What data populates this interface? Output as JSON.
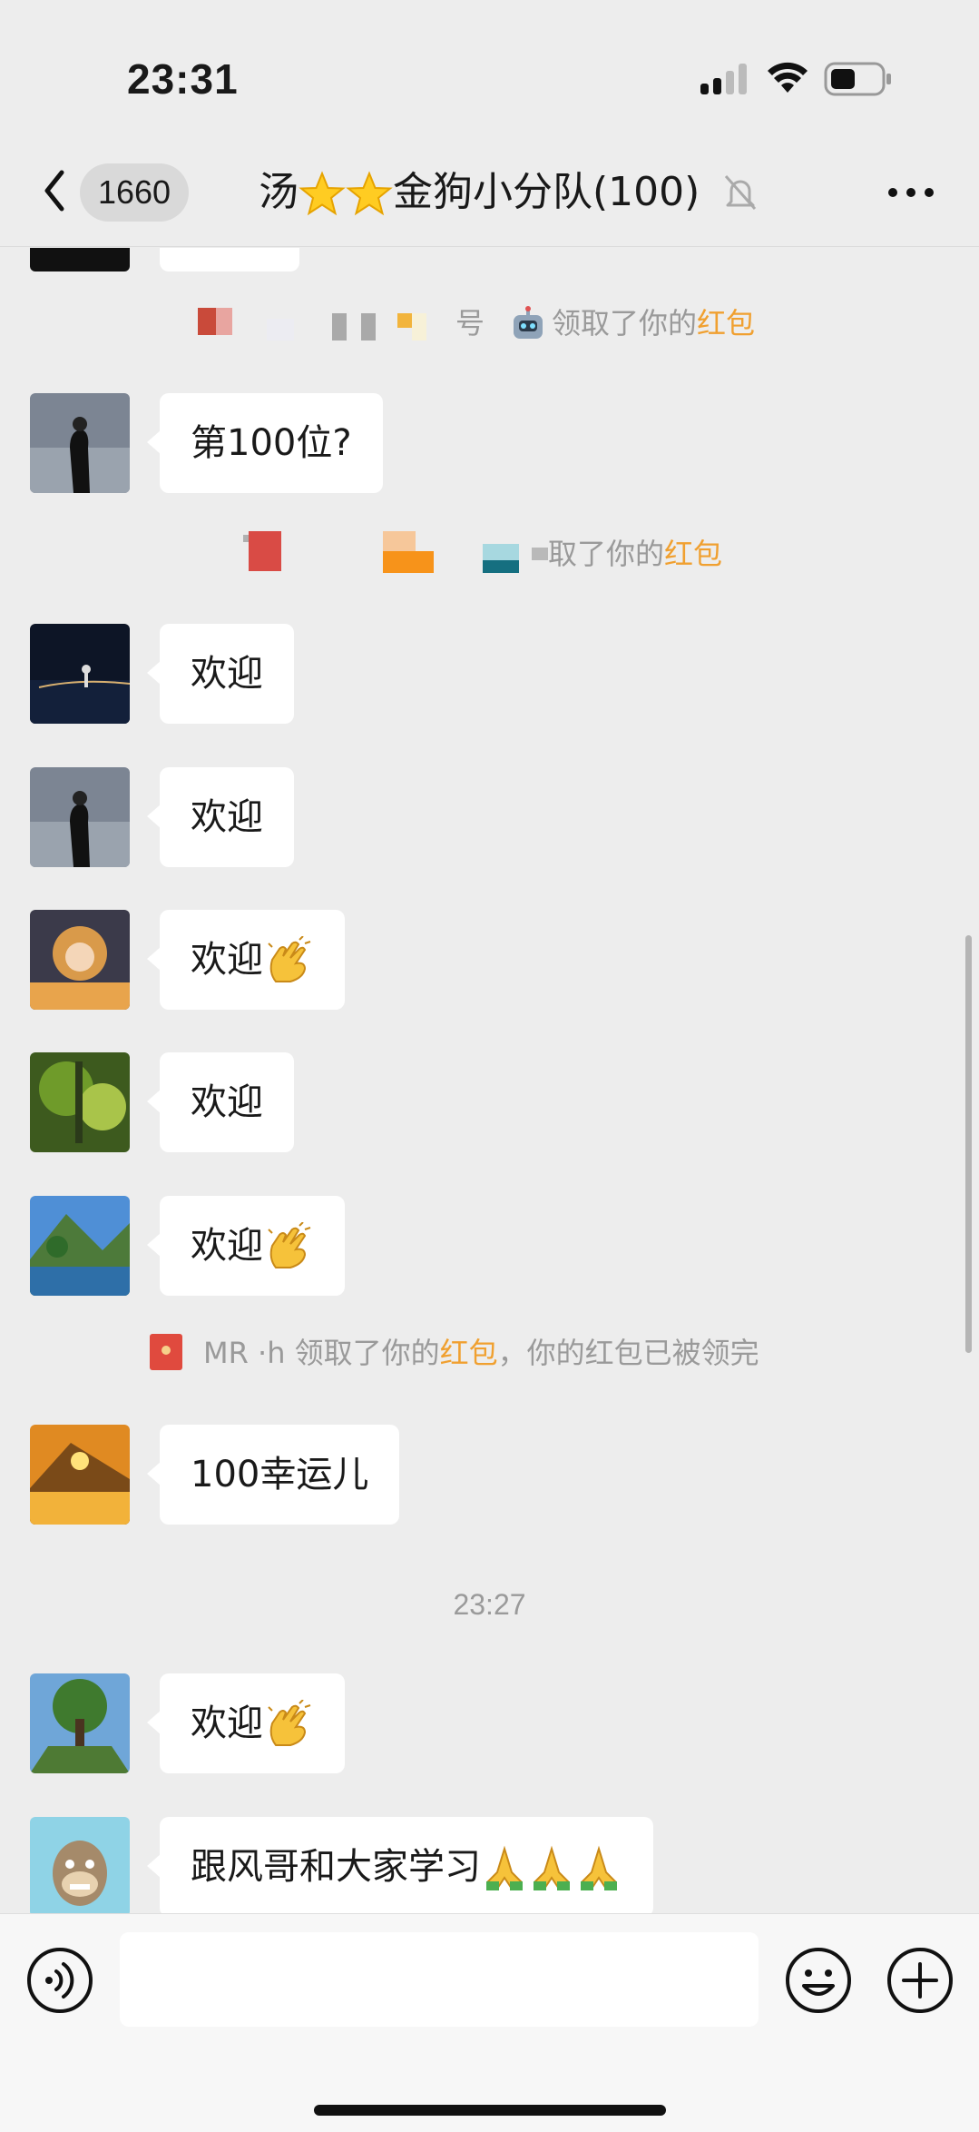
{
  "status_bar": {
    "time": "23:31",
    "icons": [
      "signal-icon",
      "wifi-icon",
      "battery-icon"
    ]
  },
  "nav": {
    "back_icon": "chevron-left-icon",
    "unread_count": "1660",
    "title_prefix": "汤",
    "title_suffix": "金狗小分队(100)",
    "mute_icon": "bell-slash-icon",
    "more_icon": "ellipsis-icon"
  },
  "system": {
    "redpack1_suffix": "号",
    "redpack1_text": "领取了你的",
    "redpack_link": "红包",
    "redpack2_text": "取了你的",
    "redpack3_name": "MR ·h",
    "redpack3_text": "领取了你的",
    "redpack3_tail": "，你的红包已被领完"
  },
  "messages": [
    {
      "text": "第100位?",
      "emoji": ""
    },
    {
      "text": "欢迎",
      "emoji": ""
    },
    {
      "text": "欢迎",
      "emoji": ""
    },
    {
      "text": "欢迎",
      "emoji": "clap"
    },
    {
      "text": "欢迎",
      "emoji": ""
    },
    {
      "text": "欢迎",
      "emoji": "clap"
    },
    {
      "text": "100幸运儿",
      "emoji": ""
    },
    {
      "text": "欢迎",
      "emoji": "clap"
    },
    {
      "text": "跟风哥和大家学习",
      "emoji": "pray x3"
    }
  ],
  "time_separator": "23:27",
  "input": {
    "voice_icon": "voice-icon",
    "emoji_icon": "smiley-icon",
    "plus_icon": "plus-circle-icon",
    "value": ""
  },
  "colors": {
    "background": "#ededed",
    "bubble": "#ffffff",
    "redpack_link": "#f0a030",
    "system_text": "#9a9a9a"
  }
}
